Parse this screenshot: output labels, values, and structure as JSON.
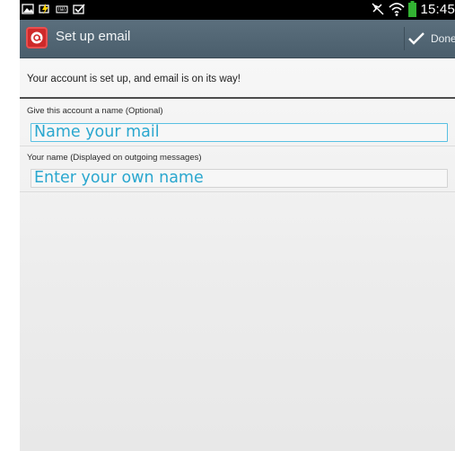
{
  "status_bar": {
    "time": "15:45",
    "left_icons": [
      "gallery-icon",
      "usb-charging-icon",
      "keyboard-icon",
      "task-check-icon"
    ],
    "right_icons": [
      "mute-icon",
      "wifi-icon",
      "battery-icon"
    ],
    "battery_color": "#33b333"
  },
  "action_bar": {
    "title": "Set up email",
    "done_label": "Done",
    "background": "#51646f",
    "app_icon": "email-app-icon"
  },
  "main": {
    "message": "Your account is set up, and email is on its way!",
    "account_name": {
      "label": "Give this account a name (Optional)",
      "value": "",
      "placeholder": "Name your mail"
    },
    "your_name": {
      "label": "Your name (Displayed on outgoing messages)",
      "value": "",
      "placeholder": "Enter your own name"
    },
    "accent_color": "#2aa7cf"
  }
}
